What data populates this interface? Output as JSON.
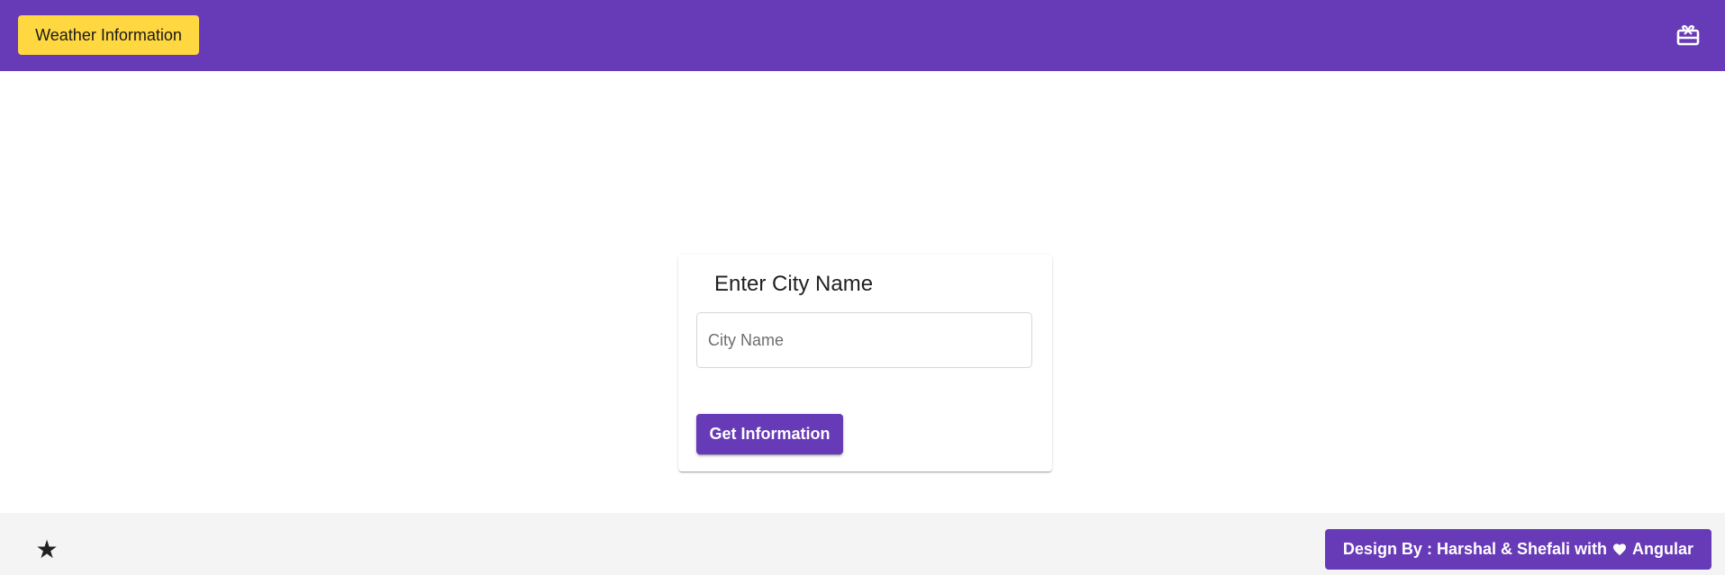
{
  "toolbar": {
    "brand_label": "Weather Information",
    "right_icon": "card-giftcard-icon"
  },
  "card": {
    "title": "Enter City Name",
    "input": {
      "placeholder": "City Name",
      "value": ""
    },
    "submit_label": "Get Information"
  },
  "footer": {
    "left_icon": "star-icon",
    "credit": {
      "prefix": "Design By : Harshal & Shefali with",
      "icon": "heart-icon",
      "suffix": "Angular"
    }
  },
  "colors": {
    "primary": "#673ab7",
    "accent": "#ffd740",
    "footer_bg": "#f4f4f4"
  }
}
